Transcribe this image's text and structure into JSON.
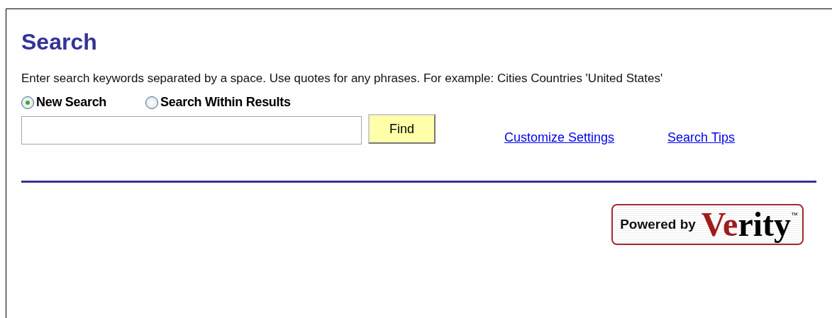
{
  "title": "Search",
  "instructions": "Enter search keywords separated by a space. Use quotes for any phrases. For example: Cities Countries 'United States'",
  "search_modes": [
    {
      "label": "New Search",
      "selected": true
    },
    {
      "label": "Search Within Results",
      "selected": false
    }
  ],
  "find_button": "Find",
  "links": [
    "Customize Settings",
    "Search Tips"
  ],
  "logo": {
    "prefix": "Powered by",
    "name_red": "Ve",
    "name_black": "rity",
    "trademark": "™"
  }
}
